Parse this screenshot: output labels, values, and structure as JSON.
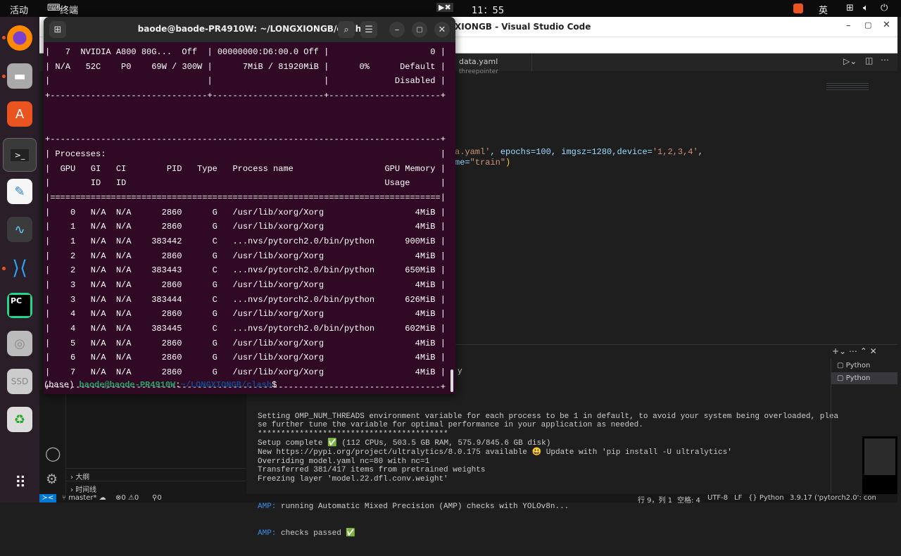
{
  "topbar": {
    "activities": "活动",
    "app": "终端",
    "time": "11：55",
    "ime": "英"
  },
  "vscode": {
    "title": "XIONGB - Visual Studio Code",
    "tab": {
      "name": "data.yaml",
      "desc": "threepointer"
    },
    "code": [
      {
        "a": "a.yaml'",
        "b": ", epochs=100, imgsz=1280,device=",
        "c": "'1,2,3,4'",
        "d": ","
      },
      {
        "a": "me=",
        "c": "\"train\"",
        "d": ")"
      }
    ],
    "panel": {
      "partial": "y",
      "lines": [
        "Setting OMP_NUM_THREADS environment variable for each process to be 1 in default, to avoid your system being overloaded, plea",
        "se further tune the variable for optimal performance in your application as needed.",
        "*****************************************",
        "Setup complete ✅ (112 CPUs, 503.5 GB RAM, 575.9/845.6 GB disk)",
        "New https://pypi.org/project/ultralytics/8.0.175 available 😃 Update with 'pip install -U ultralytics'",
        "Overriding model.yaml nc=80 with nc=1",
        "Transferred 381/417 items from pretrained weights",
        "Freezing layer 'model.22.dfl.conv.weight'"
      ],
      "amp_label": "AMP:",
      "amp1": " running Automatic Mixed Precision (AMP) checks with YOLOv8n...",
      "amp2": " checks passed ✅",
      "terminals": [
        "Python",
        "Python"
      ]
    },
    "sidebar": {
      "outline": "大纲",
      "timeline": "时间线"
    },
    "status": {
      "branch": "master*",
      "errors": "0",
      "warnings": "0",
      "ports": "0",
      "position": "行 9，列 1",
      "spaces": "空格: 4",
      "encoding": "UTF-8",
      "eol": "LF",
      "lang": "Python",
      "interpreter": "3.9.17 ('pytorch2.0': con"
    }
  },
  "terminal": {
    "title": "baode@baode-PR4910W: ~/LONGXIONGB/clash",
    "lines": [
      "|   7  NVIDIA A800 80G...  Off  | 00000000:D6:00.0 Off |                    0 |",
      "| N/A   52C    P0    69W / 300W |      7MiB / 81920MiB |      0%      Default |",
      "|                               |                      |             Disabled |",
      "+-------------------------------+----------------------+----------------------+",
      "",
      "",
      "+-----------------------------------------------------------------------------+",
      "| Processes:                                                                  |",
      "|  GPU   GI   CI        PID   Type   Process name                  GPU Memory |",
      "|        ID   ID                                                   Usage      |",
      "|=============================================================================|",
      "|    0   N/A  N/A      2860      G   /usr/lib/xorg/Xorg                  4MiB |",
      "|    1   N/A  N/A      2860      G   /usr/lib/xorg/Xorg                  4MiB |",
      "|    1   N/A  N/A    383442      C   ...nvs/pytorch2.0/bin/python      900MiB |",
      "|    2   N/A  N/A      2860      G   /usr/lib/xorg/Xorg                  4MiB |",
      "|    2   N/A  N/A    383443      C   ...nvs/pytorch2.0/bin/python      650MiB |",
      "|    3   N/A  N/A      2860      G   /usr/lib/xorg/Xorg                  4MiB |",
      "|    3   N/A  N/A    383444      C   ...nvs/pytorch2.0/bin/python      626MiB |",
      "|    4   N/A  N/A      2860      G   /usr/lib/xorg/Xorg                  4MiB |",
      "|    4   N/A  N/A    383445      C   ...nvs/pytorch2.0/bin/python      602MiB |",
      "|    5   N/A  N/A      2860      G   /usr/lib/xorg/Xorg                  4MiB |",
      "|    6   N/A  N/A      2860      G   /usr/lib/xorg/Xorg                  4MiB |",
      "|    7   N/A  N/A      2860      G   /usr/lib/xorg/Xorg                  4MiB |",
      "+-----------------------------------------------------------------------------+"
    ],
    "prompt": {
      "env": "(base) ",
      "user": "baode@baode-PR4910W",
      "sep": ":",
      "path": "~/LONGXIONGB/clash",
      "end": "$"
    }
  },
  "dock": {
    "ssd_label": "SSD"
  }
}
